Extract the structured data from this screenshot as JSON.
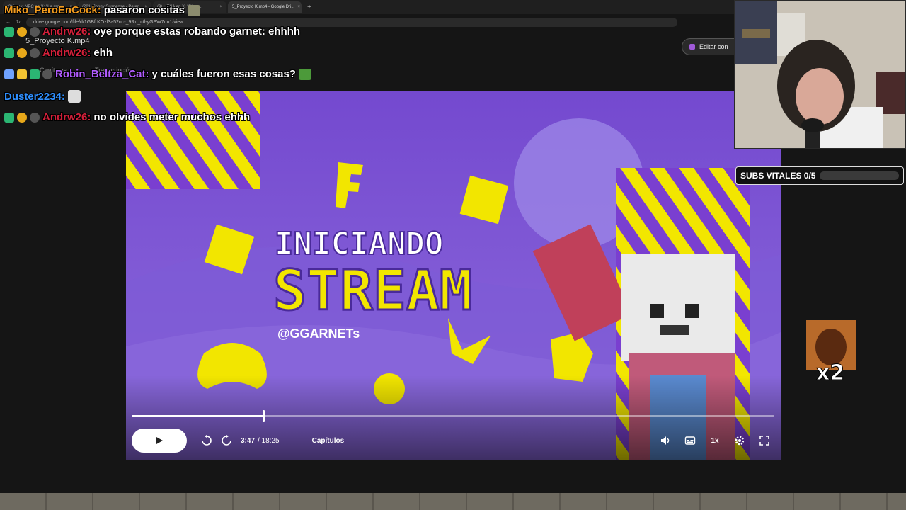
{
  "browser": {
    "tabs": [
      {
        "label": "(9) Luck_NPC en X: \"La ma...",
        "active": false
      },
      {
        "label": "(281) Jonny Suspense - Peter...",
        "active": false
      },
      {
        "label": "(9) HEXA en X: \"Bienv...",
        "active": false
      },
      {
        "label": "5_Proyecto K.mp4 - Google Dri...",
        "active": true
      }
    ],
    "url": "drive.google.com/file/d/1GBfrKOzl3a52nc-_9Ru_ctl-yGSW7uu1/view"
  },
  "viewer": {
    "file_title": "5_Proyecto K.mp4",
    "edit_button": "Editar con",
    "tabs": [
      "Capítulos",
      "Transcripción"
    ]
  },
  "player": {
    "current_time": "3:47",
    "duration": "/ 18:25",
    "progress": 0.205,
    "chapters_label": "Capítulos",
    "speed": "1x"
  },
  "chat": [
    {
      "user": "Miko_PeroEnCock:",
      "text": "pasaron cositas",
      "color": "#f29b1e"
    },
    {
      "user": "Andrw26:",
      "text": "oye porque estas robando garnet: ehhhh",
      "color": "#d4203a"
    },
    {
      "user": "Andrw26:",
      "text": "ehh",
      "color": "#d4203a"
    },
    {
      "user": "Robin_Beltza_Cat:",
      "text": "y cuáles fueron esas cosas?",
      "color": "#b25cff"
    },
    {
      "user": "Duster2234:",
      "text": "",
      "color": "#2f8fff"
    },
    {
      "user": "Andrw26:",
      "text": "no olvides meter muchos ehhh",
      "color": "#d4203a"
    }
  ],
  "subs_widget": {
    "label": "SUBS VITALES 0/5",
    "progress": 0.0
  },
  "alert": {
    "multiplier": "x2"
  },
  "thumbnail": {
    "line1": "INICIANDO",
    "line2": "STREAM",
    "handle": "@GGARNETs"
  },
  "colors": {
    "accent_purple": "#6c45c4",
    "accent_yellow": "#f2e600"
  }
}
